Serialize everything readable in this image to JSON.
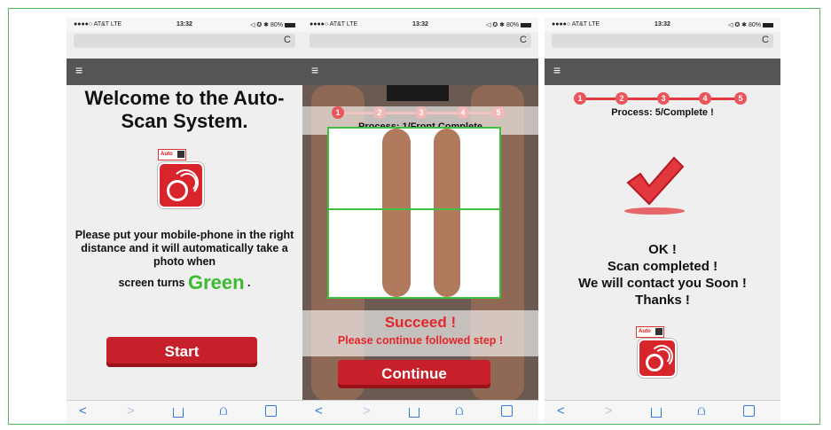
{
  "status_bar": {
    "carrier": "●●●●○ AT&T  LTE",
    "time": "13:32",
    "right": "◁ ✪ ✱ 80%"
  },
  "menu_icon": "≡",
  "reload_icon": "C",
  "toolbar_icons": [
    "back-icon",
    "forward-icon",
    "share-icon",
    "bookmarks-icon",
    "tabs-icon"
  ],
  "toolbar_glyphs": {
    "back": "<",
    "forward": ">",
    "bookmarks": "⩍"
  },
  "screen1": {
    "title": "Welcome to the Auto-Scan System.",
    "auto_label": "Auto",
    "instruction": "Please put your mobile-phone in the right distance and it will automatically take a photo when",
    "instruction_end_prefix": "screen turns",
    "instruction_highlight": "Green",
    "instruction_end_suffix": ".",
    "button": "Start"
  },
  "screen2": {
    "steps": [
      "1",
      "2",
      "3",
      "4",
      "5"
    ],
    "process": "Process: 1/Front Complete",
    "success": "Succeed !",
    "success_sub": "Please continue followed step !",
    "button": "Continue"
  },
  "screen3": {
    "steps": [
      "1",
      "2",
      "3",
      "4",
      "5"
    ],
    "process": "Process: 5/Complete !",
    "ok": "OK !",
    "line2": "Scan completed !",
    "line3": "We will contact you Soon !",
    "line4": "Thanks !",
    "auto_label": "Auto"
  },
  "colors": {
    "brand_red": "#d8252b",
    "success_green": "#3cba30",
    "scan_green": "#3fbf3f",
    "frame_green": "#55b85a"
  }
}
